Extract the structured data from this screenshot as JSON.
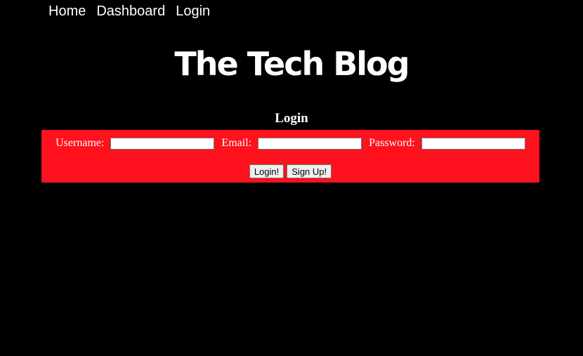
{
  "nav": {
    "items": [
      {
        "label": "Home"
      },
      {
        "label": "Dashboard"
      },
      {
        "label": "Login"
      }
    ]
  },
  "header": {
    "title": "The Tech Blog"
  },
  "login": {
    "heading": "Login",
    "username_label": "Username:",
    "username_value": "",
    "email_label": "Email:",
    "email_value": "",
    "password_label": "Password:",
    "password_value": "",
    "login_button": "Login!",
    "signup_button": "Sign Up!"
  },
  "colors": {
    "background": "#000000",
    "panel": "#ff111e",
    "text": "#ffffff"
  }
}
